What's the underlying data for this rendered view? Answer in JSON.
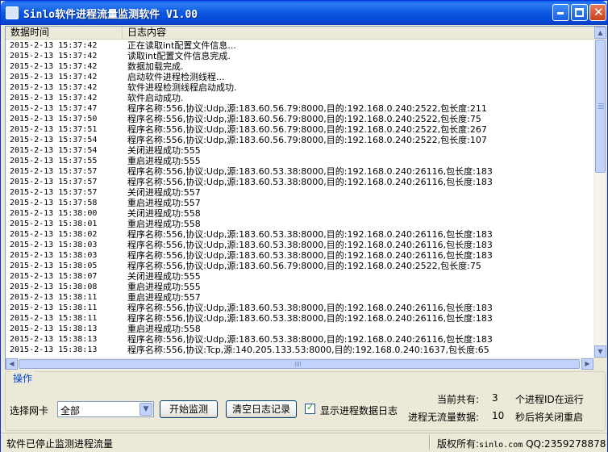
{
  "window": {
    "title": "Sinlo软件进程流量监测软件 V1.00"
  },
  "log": {
    "columns": [
      "数据时间",
      "日志内容"
    ],
    "rows": [
      [
        "2015-2-13 15:37:42",
        "正在读取int配置文件信息..."
      ],
      [
        "2015-2-13 15:37:42",
        "读取int配置文件信息完成."
      ],
      [
        "2015-2-13 15:37:42",
        "数据加载完成."
      ],
      [
        "2015-2-13 15:37:42",
        "启动软件进程检测线程..."
      ],
      [
        "2015-2-13 15:37:42",
        "软件进程检测线程启动成功."
      ],
      [
        "2015-2-13 15:37:42",
        "软件启动成功."
      ],
      [
        "2015-2-13 15:37:47",
        "程序名称:556,协议:Udp,源:183.60.56.79:8000,目的:192.168.0.240:2522,包长度:211"
      ],
      [
        "2015-2-13 15:37:50",
        "程序名称:556,协议:Udp,源:183.60.56.79:8000,目的:192.168.0.240:2522,包长度:75"
      ],
      [
        "2015-2-13 15:37:51",
        "程序名称:556,协议:Udp,源:183.60.56.79:8000,目的:192.168.0.240:2522,包长度:267"
      ],
      [
        "2015-2-13 15:37:54",
        "程序名称:556,协议:Udp,源:183.60.56.79:8000,目的:192.168.0.240:2522,包长度:107"
      ],
      [
        "2015-2-13 15:37:54",
        "关闭进程成功:555"
      ],
      [
        "2015-2-13 15:37:55",
        "重启进程成功:555"
      ],
      [
        "2015-2-13 15:37:57",
        "程序名称:556,协议:Udp,源:183.60.53.38:8000,目的:192.168.0.240:26116,包长度:183"
      ],
      [
        "2015-2-13 15:37:57",
        "程序名称:556,协议:Udp,源:183.60.53.38:8000,目的:192.168.0.240:26116,包长度:183"
      ],
      [
        "2015-2-13 15:37:57",
        "关闭进程成功:557"
      ],
      [
        "2015-2-13 15:37:58",
        "重启进程成功:557"
      ],
      [
        "2015-2-13 15:38:00",
        "关闭进程成功:558"
      ],
      [
        "2015-2-13 15:38:01",
        "重启进程成功:558"
      ],
      [
        "2015-2-13 15:38:02",
        "程序名称:556,协议:Udp,源:183.60.53.38:8000,目的:192.168.0.240:26116,包长度:183"
      ],
      [
        "2015-2-13 15:38:03",
        "程序名称:556,协议:Udp,源:183.60.53.38:8000,目的:192.168.0.240:26116,包长度:183"
      ],
      [
        "2015-2-13 15:38:03",
        "程序名称:556,协议:Udp,源:183.60.53.38:8000,目的:192.168.0.240:26116,包长度:183"
      ],
      [
        "2015-2-13 15:38:05",
        "程序名称:556,协议:Udp,源:183.60.56.79:8000,目的:192.168.0.240:2522,包长度:75"
      ],
      [
        "2015-2-13 15:38:07",
        "关闭进程成功:555"
      ],
      [
        "2015-2-13 15:38:08",
        "重启进程成功:555"
      ],
      [
        "2015-2-13 15:38:11",
        "重启进程成功:557"
      ],
      [
        "2015-2-13 15:38:11",
        "程序名称:556,协议:Udp,源:183.60.53.38:8000,目的:192.168.0.240:26116,包长度:183"
      ],
      [
        "2015-2-13 15:38:11",
        "程序名称:556,协议:Udp,源:183.60.53.38:8000,目的:192.168.0.240:26116,包长度:183"
      ],
      [
        "2015-2-13 15:38:13",
        "重启进程成功:558"
      ],
      [
        "2015-2-13 15:38:13",
        "程序名称:556,协议:Udp,源:183.60.53.38:8000,目的:192.168.0.240:26116,包长度:183"
      ],
      [
        "2015-2-13 15:38:13",
        "程序名称:556,协议:Tcp,源:140.205.133.53:8000,目的:192.168.0.240:1637,包长度:65"
      ]
    ]
  },
  "operations": {
    "legend": "操作",
    "nic_label": "选择网卡",
    "nic_selected": "全部",
    "start_button": "开始监测",
    "clear_button": "清空日志记录",
    "show_log_checkbox": "显示进程数据日志",
    "show_log_checked": true,
    "current_total_label": "当前共有:",
    "current_total_value": "3",
    "running_suffix": "个进程ID在运行",
    "no_traffic_label": "进程无流量数据:",
    "no_traffic_value": "10",
    "restart_suffix": "秒后将关闭重启"
  },
  "status": {
    "left": "软件已停止监测进程流量",
    "copyright_prefix": "版权所有:",
    "site": "sinlo.com",
    "qq": "QQ:2359278878"
  },
  "icons": {
    "app": "app-icon",
    "minimize": "minimize-icon",
    "maximize": "maximize-icon",
    "close": "close-icon",
    "dropdown": "chevron-down-icon",
    "check": "check-icon"
  },
  "colors": {
    "titlebar": "#0b58e0",
    "window_bg": "#ece9d8",
    "legend_text": "#0046d5",
    "close_button": "#d85a34"
  }
}
